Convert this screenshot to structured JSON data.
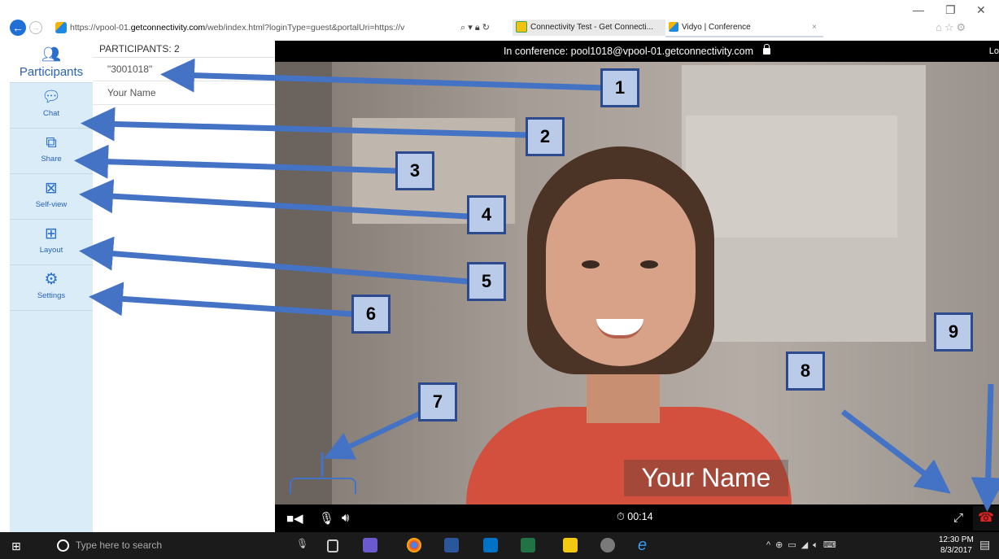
{
  "browser": {
    "address_prefix": "https://vpool-01.",
    "address_domain": "getconnectivity.com",
    "address_rest": "/web/index.html?loginType=guest&portalUri=https://v",
    "tabs": [
      {
        "label": "Connectivity Test - Get Connecti...",
        "icon": "connectivity-favicon"
      },
      {
        "label": "Vidyo | Conference",
        "icon": "vidyo-favicon"
      }
    ],
    "tab_close": "×"
  },
  "sidebar": {
    "items": [
      {
        "label": "Participants",
        "icon": "participants-icon"
      },
      {
        "label": "Chat",
        "icon": "chat-icon"
      },
      {
        "label": "Share",
        "icon": "share-icon"
      },
      {
        "label": "Self-view",
        "icon": "self-view-icon"
      },
      {
        "label": "Layout",
        "icon": "layout-icon"
      },
      {
        "label": "Settings",
        "icon": "settings-icon"
      }
    ]
  },
  "participants": {
    "header": "PARTICIPANTS: 2",
    "list": [
      "\"3001018\"",
      "Your Name"
    ]
  },
  "conference": {
    "status": "In conference: pool1018@vpool-01.getconnectivity.com",
    "top_right": "Lo",
    "name_overlay": "Your Name",
    "timer": "00:14"
  },
  "taskbar": {
    "search_placeholder": "Type here to search",
    "time": "12:30 PM",
    "date": "8/3/2017"
  },
  "annotations": [
    "1",
    "2",
    "3",
    "4",
    "5",
    "6",
    "7",
    "8",
    "9"
  ],
  "colors": {
    "sidebar_bg": "#d9ecf7",
    "accent_blue": "#2b6fd1",
    "callout_fill": "#b9cbe9",
    "callout_border": "#2c4a8c",
    "arrow": "#4472c4",
    "hangup_red": "#e02424"
  }
}
